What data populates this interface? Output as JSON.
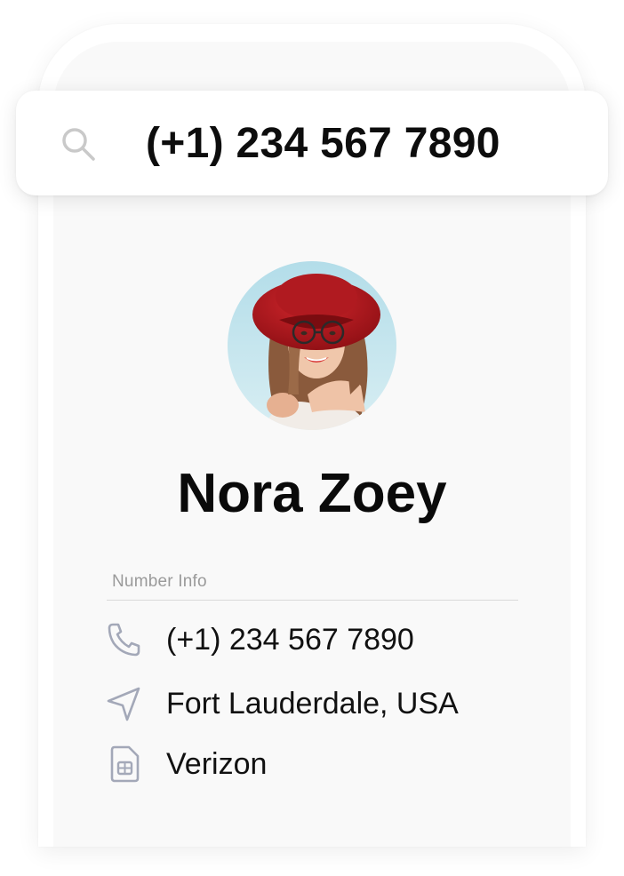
{
  "search": {
    "value": "(+1) 234 567 7890",
    "icon": "search-icon"
  },
  "contact": {
    "name": "Nora Zoey",
    "avatar": "avatar"
  },
  "number_info": {
    "label": "Number Info",
    "items": [
      {
        "icon": "phone-icon",
        "text": "(+1) 234 567 7890"
      },
      {
        "icon": "location-arrow-icon",
        "text": "Fort Lauderdale, USA"
      },
      {
        "icon": "sim-card-icon",
        "text": "Verizon"
      }
    ]
  },
  "colors": {
    "screen_background": "#f9f9f9",
    "icon_gray": "#a3a8b8",
    "text_dark": "#0d0d0d",
    "label_gray": "#9a9a9a"
  }
}
